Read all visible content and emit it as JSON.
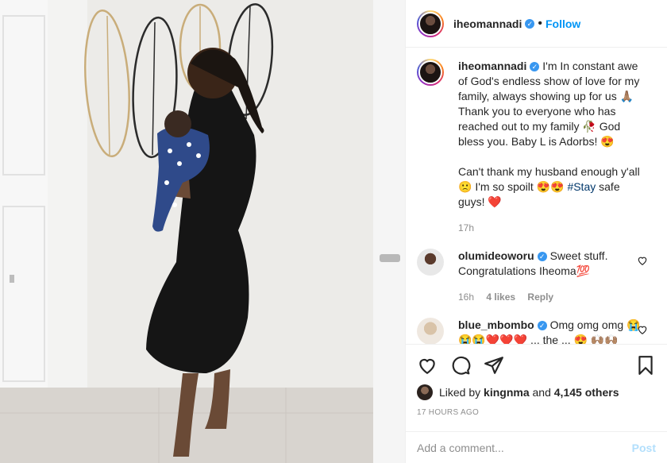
{
  "header": {
    "username": "iheomannadi",
    "follow_label": "Follow",
    "separator": "•"
  },
  "caption": {
    "username": "iheomannadi",
    "line1": "I'm In constant awe of God's endless show of love for my family, always showing up for us 🙏🏽 Thank you to everyone who has reached out to my family 🥀 God bless you. Baby L is Adorbs! 😍",
    "line2_pre": "Can't thank my husband enough y'all 🙁 I'm so spoilt 😍😍 ",
    "hashtag": "#Stay",
    "line2_post": " safe guys! ❤️",
    "time": "17h"
  },
  "comments": [
    {
      "username": "olumideoworu",
      "text": "Sweet stuff. Congratulations Iheoma💯",
      "time": "16h",
      "likes": "4 likes",
      "reply": "Reply"
    },
    {
      "username": "blue_mbombo",
      "text": "Omg omg omg 😭😭😭❤️❤️❤️ ... the ... 😍 🙌🏽🙌🏽"
    }
  ],
  "likes": {
    "prefix": "Liked by",
    "user": "kingnma",
    "and": "and",
    "count": "4,145 others"
  },
  "timestamp": "17 HOURS AGO",
  "add_comment": {
    "placeholder": "Add a comment...",
    "post_label": "Post"
  },
  "colors": {
    "accent": "#0095f6",
    "verified": "#3897f0",
    "post_disabled": "#b2dffc"
  }
}
